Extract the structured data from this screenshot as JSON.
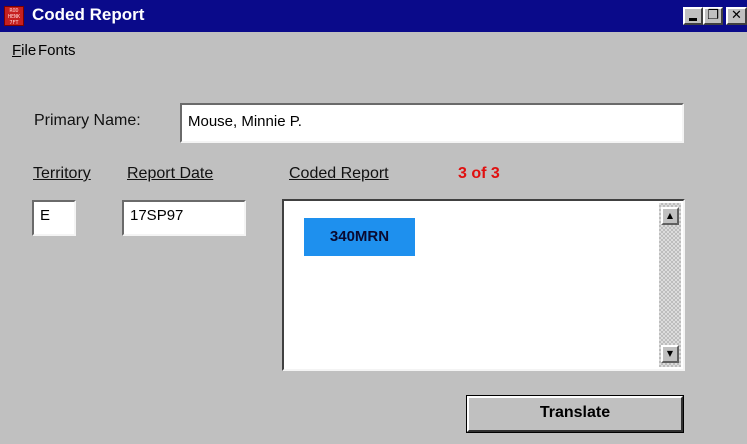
{
  "window": {
    "title": "Coded Report",
    "app_icon_text": "ROD HENK 7FT",
    "titlebar_color": "#0a0a8a"
  },
  "controls": {
    "minimize_icon": "minimize-icon",
    "maximize_glyph": "❐",
    "close_glyph": "✕"
  },
  "menu": {
    "file_first": "F",
    "file_rest": "ile",
    "fonts": "Fonts"
  },
  "form": {
    "primary_name_label": "Primary Name:",
    "primary_name_value": "Mouse, Minnie P.",
    "territory_label": "Territory",
    "territory_value": "E",
    "report_date_label": "Report Date",
    "report_date_value": "17SP97",
    "coded_report_label": "Coded Report",
    "record_count": "3 of 3",
    "record_count_color": "#e01010"
  },
  "coded_report": {
    "selected_code": "340MRN",
    "selection_color": "#1e90ee",
    "scroll_up_glyph": "▲",
    "scroll_down_glyph": "▼"
  },
  "actions": {
    "translate_label": "Translate"
  }
}
